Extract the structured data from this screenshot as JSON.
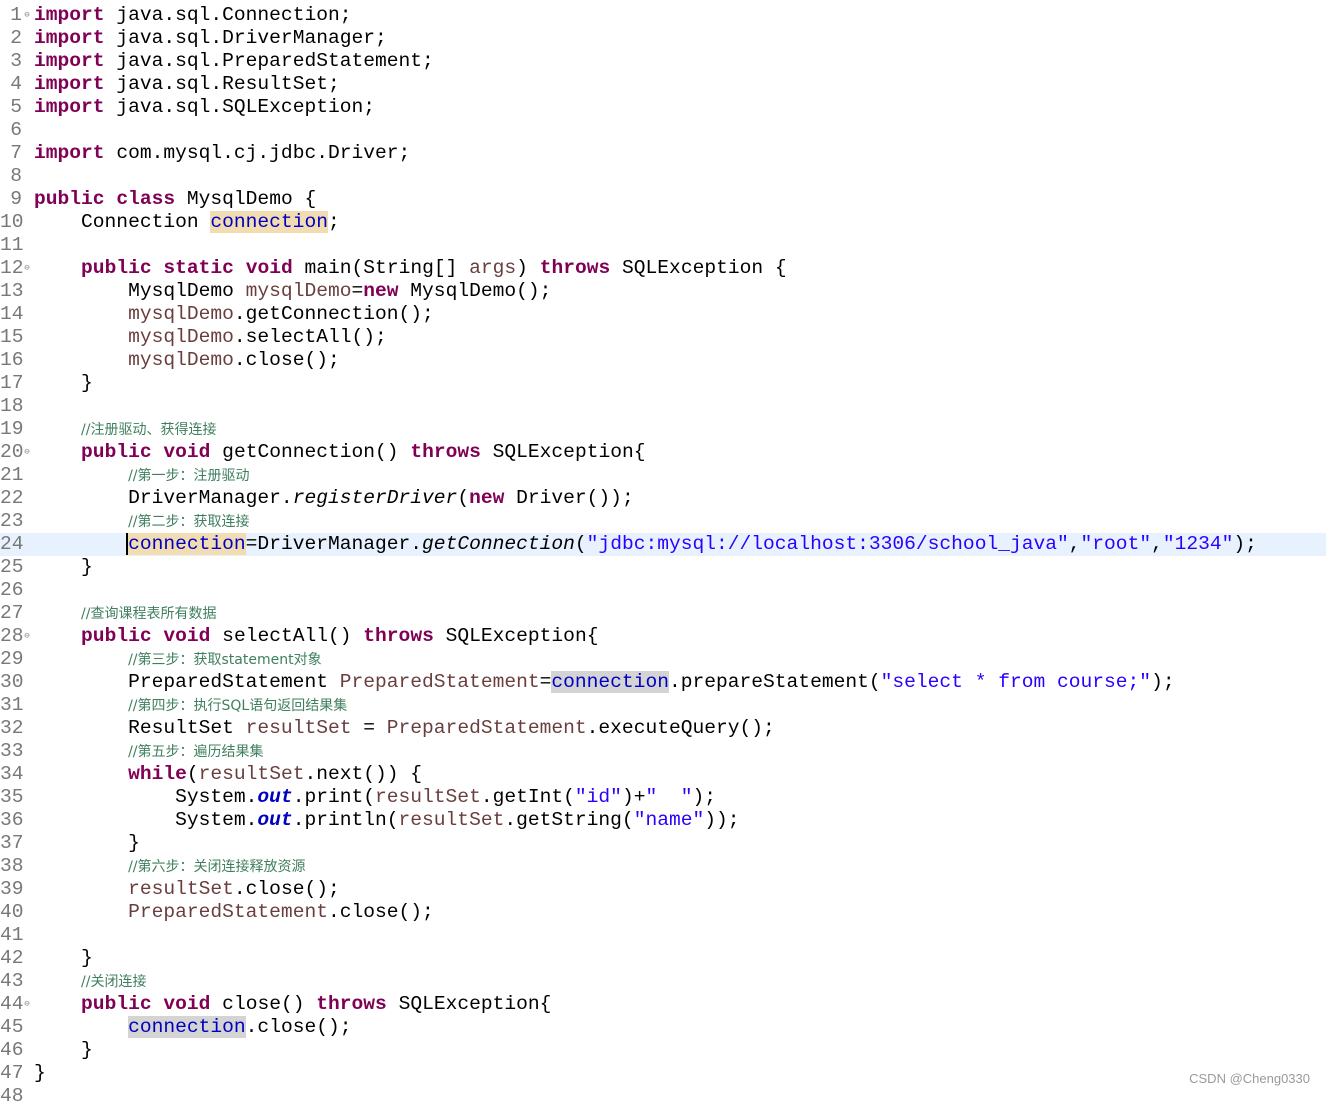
{
  "watermark": "CSDN @Cheng0330",
  "colors": {
    "keyword": "#7f0055",
    "local_variable": "#6a3e3e",
    "field": "#0000c0",
    "string": "#2a00ff",
    "comment": "#3f7f5f",
    "line_number": "#787878",
    "current_line": "#e8f2fe",
    "occurrence_highlight": "#f2dcb2"
  },
  "lines": [
    {
      "n": "1",
      "fold": true,
      "tokens": [
        [
          "kw",
          "import"
        ],
        [
          "p",
          " java.sql.Connection;"
        ]
      ]
    },
    {
      "n": "2",
      "tokens": [
        [
          "kw",
          "import"
        ],
        [
          "p",
          " java.sql.DriverManager;"
        ]
      ]
    },
    {
      "n": "3",
      "tokens": [
        [
          "kw",
          "import"
        ],
        [
          "p",
          " java.sql.PreparedStatement;"
        ]
      ]
    },
    {
      "n": "4",
      "tokens": [
        [
          "kw",
          "import"
        ],
        [
          "p",
          " java.sql.ResultSet;"
        ]
      ]
    },
    {
      "n": "5",
      "tokens": [
        [
          "kw",
          "import"
        ],
        [
          "p",
          " java.sql.SQLException;"
        ]
      ]
    },
    {
      "n": "6",
      "tokens": []
    },
    {
      "n": "7",
      "tokens": [
        [
          "kw",
          "import"
        ],
        [
          "p",
          " com.mysql.cj.jdbc.Driver;"
        ]
      ]
    },
    {
      "n": "8",
      "tokens": []
    },
    {
      "n": "9",
      "tokens": [
        [
          "kw",
          "public"
        ],
        [
          "p",
          " "
        ],
        [
          "kw",
          "class"
        ],
        [
          "p",
          " MysqlDemo {"
        ]
      ]
    },
    {
      "n": "10",
      "tokens": [
        [
          "p",
          "    Connection "
        ],
        [
          "field occ",
          "connection"
        ],
        [
          "p",
          ";"
        ]
      ]
    },
    {
      "n": "11",
      "tokens": []
    },
    {
      "n": "12",
      "fold": true,
      "tokens": [
        [
          "p",
          "    "
        ],
        [
          "kw",
          "public"
        ],
        [
          "p",
          " "
        ],
        [
          "kw",
          "static"
        ],
        [
          "p",
          " "
        ],
        [
          "kw",
          "void"
        ],
        [
          "p",
          " main(String[] "
        ],
        [
          "var",
          "args"
        ],
        [
          "p",
          ") "
        ],
        [
          "kw",
          "throws"
        ],
        [
          "p",
          " SQLException {"
        ]
      ]
    },
    {
      "n": "13",
      "tokens": [
        [
          "p",
          "        MysqlDemo "
        ],
        [
          "var",
          "mysqlDemo"
        ],
        [
          "p",
          "="
        ],
        [
          "kw",
          "new"
        ],
        [
          "p",
          " MysqlDemo();"
        ]
      ]
    },
    {
      "n": "14",
      "tokens": [
        [
          "p",
          "        "
        ],
        [
          "var",
          "mysqlDemo"
        ],
        [
          "p",
          ".getConnection();"
        ]
      ]
    },
    {
      "n": "15",
      "tokens": [
        [
          "p",
          "        "
        ],
        [
          "var",
          "mysqlDemo"
        ],
        [
          "p",
          ".selectAll();"
        ]
      ]
    },
    {
      "n": "16",
      "tokens": [
        [
          "p",
          "        "
        ],
        [
          "var",
          "mysqlDemo"
        ],
        [
          "p",
          ".close();"
        ]
      ]
    },
    {
      "n": "17",
      "tokens": [
        [
          "p",
          "    }"
        ]
      ]
    },
    {
      "n": "18",
      "tokens": []
    },
    {
      "n": "19",
      "tokens": [
        [
          "p",
          "    "
        ],
        [
          "cmt",
          "//注册驱动、获得连接"
        ]
      ]
    },
    {
      "n": "20",
      "fold": true,
      "tokens": [
        [
          "p",
          "    "
        ],
        [
          "kw",
          "public"
        ],
        [
          "p",
          " "
        ],
        [
          "kw",
          "void"
        ],
        [
          "p",
          " getConnection() "
        ],
        [
          "kw",
          "throws"
        ],
        [
          "p",
          " SQLException{"
        ]
      ]
    },
    {
      "n": "21",
      "tokens": [
        [
          "p",
          "        "
        ],
        [
          "cmt",
          "//第一步：注册驱动"
        ]
      ]
    },
    {
      "n": "22",
      "tokens": [
        [
          "p",
          "        DriverManager."
        ],
        [
          "ital",
          "registerDriver"
        ],
        [
          "p",
          "("
        ],
        [
          "kw",
          "new"
        ],
        [
          "p",
          " Driver());"
        ]
      ]
    },
    {
      "n": "23",
      "tokens": [
        [
          "p",
          "        "
        ],
        [
          "cmt",
          "//第二步：获取连接"
        ]
      ]
    },
    {
      "n": "24",
      "current": true,
      "tokens": [
        [
          "p",
          "        "
        ],
        [
          "field occ caret",
          "connection"
        ],
        [
          "p",
          "=DriverManager."
        ],
        [
          "ital",
          "getConnection"
        ],
        [
          "p",
          "("
        ],
        [
          "str",
          "\"jdbc:mysql://localhost:3306/school_java\""
        ],
        [
          "p",
          ","
        ],
        [
          "str",
          "\"root\""
        ],
        [
          "p",
          ","
        ],
        [
          "str",
          "\"1234\""
        ],
        [
          "p",
          ");"
        ]
      ]
    },
    {
      "n": "25",
      "tokens": [
        [
          "p",
          "    }"
        ]
      ]
    },
    {
      "n": "26",
      "tokens": []
    },
    {
      "n": "27",
      "tokens": [
        [
          "p",
          "    "
        ],
        [
          "cmt",
          "//查询课程表所有数据"
        ]
      ]
    },
    {
      "n": "28",
      "fold": true,
      "tokens": [
        [
          "p",
          "    "
        ],
        [
          "kw",
          "public"
        ],
        [
          "p",
          " "
        ],
        [
          "kw",
          "void"
        ],
        [
          "p",
          " selectAll() "
        ],
        [
          "kw",
          "throws"
        ],
        [
          "p",
          " SQLException{"
        ]
      ]
    },
    {
      "n": "29",
      "tokens": [
        [
          "p",
          "        "
        ],
        [
          "cmt",
          "//第三步：获取statement对象"
        ]
      ]
    },
    {
      "n": "30",
      "tokens": [
        [
          "p",
          "        PreparedStatement "
        ],
        [
          "var",
          "PreparedStatement"
        ],
        [
          "p",
          "="
        ],
        [
          "field occg",
          "connection"
        ],
        [
          "p",
          ".prepareStatement("
        ],
        [
          "str",
          "\"select * from course;\""
        ],
        [
          "p",
          ");"
        ]
      ]
    },
    {
      "n": "31",
      "tokens": [
        [
          "p",
          "        "
        ],
        [
          "cmt",
          "//第四步：执行SQL语句返回结果集"
        ]
      ]
    },
    {
      "n": "32",
      "tokens": [
        [
          "p",
          "        ResultSet "
        ],
        [
          "var",
          "resultSet"
        ],
        [
          "p",
          " = "
        ],
        [
          "var",
          "PreparedStatement"
        ],
        [
          "p",
          ".executeQuery();"
        ]
      ]
    },
    {
      "n": "33",
      "tokens": [
        [
          "p",
          "        "
        ],
        [
          "cmt",
          "//第五步：遍历结果集"
        ]
      ]
    },
    {
      "n": "34",
      "tokens": [
        [
          "p",
          "        "
        ],
        [
          "kw",
          "while"
        ],
        [
          "p",
          "("
        ],
        [
          "var",
          "resultSet"
        ],
        [
          "p",
          ".next()) {"
        ]
      ]
    },
    {
      "n": "35",
      "tokens": [
        [
          "p",
          "            System."
        ],
        [
          "sfield",
          "out"
        ],
        [
          "p",
          ".print("
        ],
        [
          "var",
          "resultSet"
        ],
        [
          "p",
          ".getInt("
        ],
        [
          "str",
          "\"id\""
        ],
        [
          "p",
          ")+"
        ],
        [
          "str",
          "\"  \""
        ],
        [
          "p",
          ");"
        ]
      ]
    },
    {
      "n": "36",
      "tokens": [
        [
          "p",
          "            System."
        ],
        [
          "sfield",
          "out"
        ],
        [
          "p",
          ".println("
        ],
        [
          "var",
          "resultSet"
        ],
        [
          "p",
          ".getString("
        ],
        [
          "str",
          "\"name\""
        ],
        [
          "p",
          "));"
        ]
      ]
    },
    {
      "n": "37",
      "tokens": [
        [
          "p",
          "        }"
        ]
      ]
    },
    {
      "n": "38",
      "tokens": [
        [
          "p",
          "        "
        ],
        [
          "cmt",
          "//第六步：关闭连接释放资源"
        ]
      ]
    },
    {
      "n": "39",
      "tokens": [
        [
          "p",
          "        "
        ],
        [
          "var",
          "resultSet"
        ],
        [
          "p",
          ".close();"
        ]
      ]
    },
    {
      "n": "40",
      "tokens": [
        [
          "p",
          "        "
        ],
        [
          "var",
          "PreparedStatement"
        ],
        [
          "p",
          ".close();"
        ]
      ]
    },
    {
      "n": "41",
      "tokens": []
    },
    {
      "n": "42",
      "tokens": [
        [
          "p",
          "    }"
        ]
      ]
    },
    {
      "n": "43",
      "tokens": [
        [
          "p",
          "    "
        ],
        [
          "cmt",
          "//关闭连接"
        ]
      ]
    },
    {
      "n": "44",
      "fold": true,
      "tokens": [
        [
          "p",
          "    "
        ],
        [
          "kw",
          "public"
        ],
        [
          "p",
          " "
        ],
        [
          "kw",
          "void"
        ],
        [
          "p",
          " close() "
        ],
        [
          "kw",
          "throws"
        ],
        [
          "p",
          " SQLException{"
        ]
      ]
    },
    {
      "n": "45",
      "tokens": [
        [
          "p",
          "        "
        ],
        [
          "field occg",
          "connection"
        ],
        [
          "p",
          ".close();"
        ]
      ]
    },
    {
      "n": "46",
      "tokens": [
        [
          "p",
          "    }"
        ]
      ]
    },
    {
      "n": "47",
      "tokens": [
        [
          "p",
          "}"
        ]
      ]
    },
    {
      "n": "48",
      "tokens": []
    }
  ]
}
